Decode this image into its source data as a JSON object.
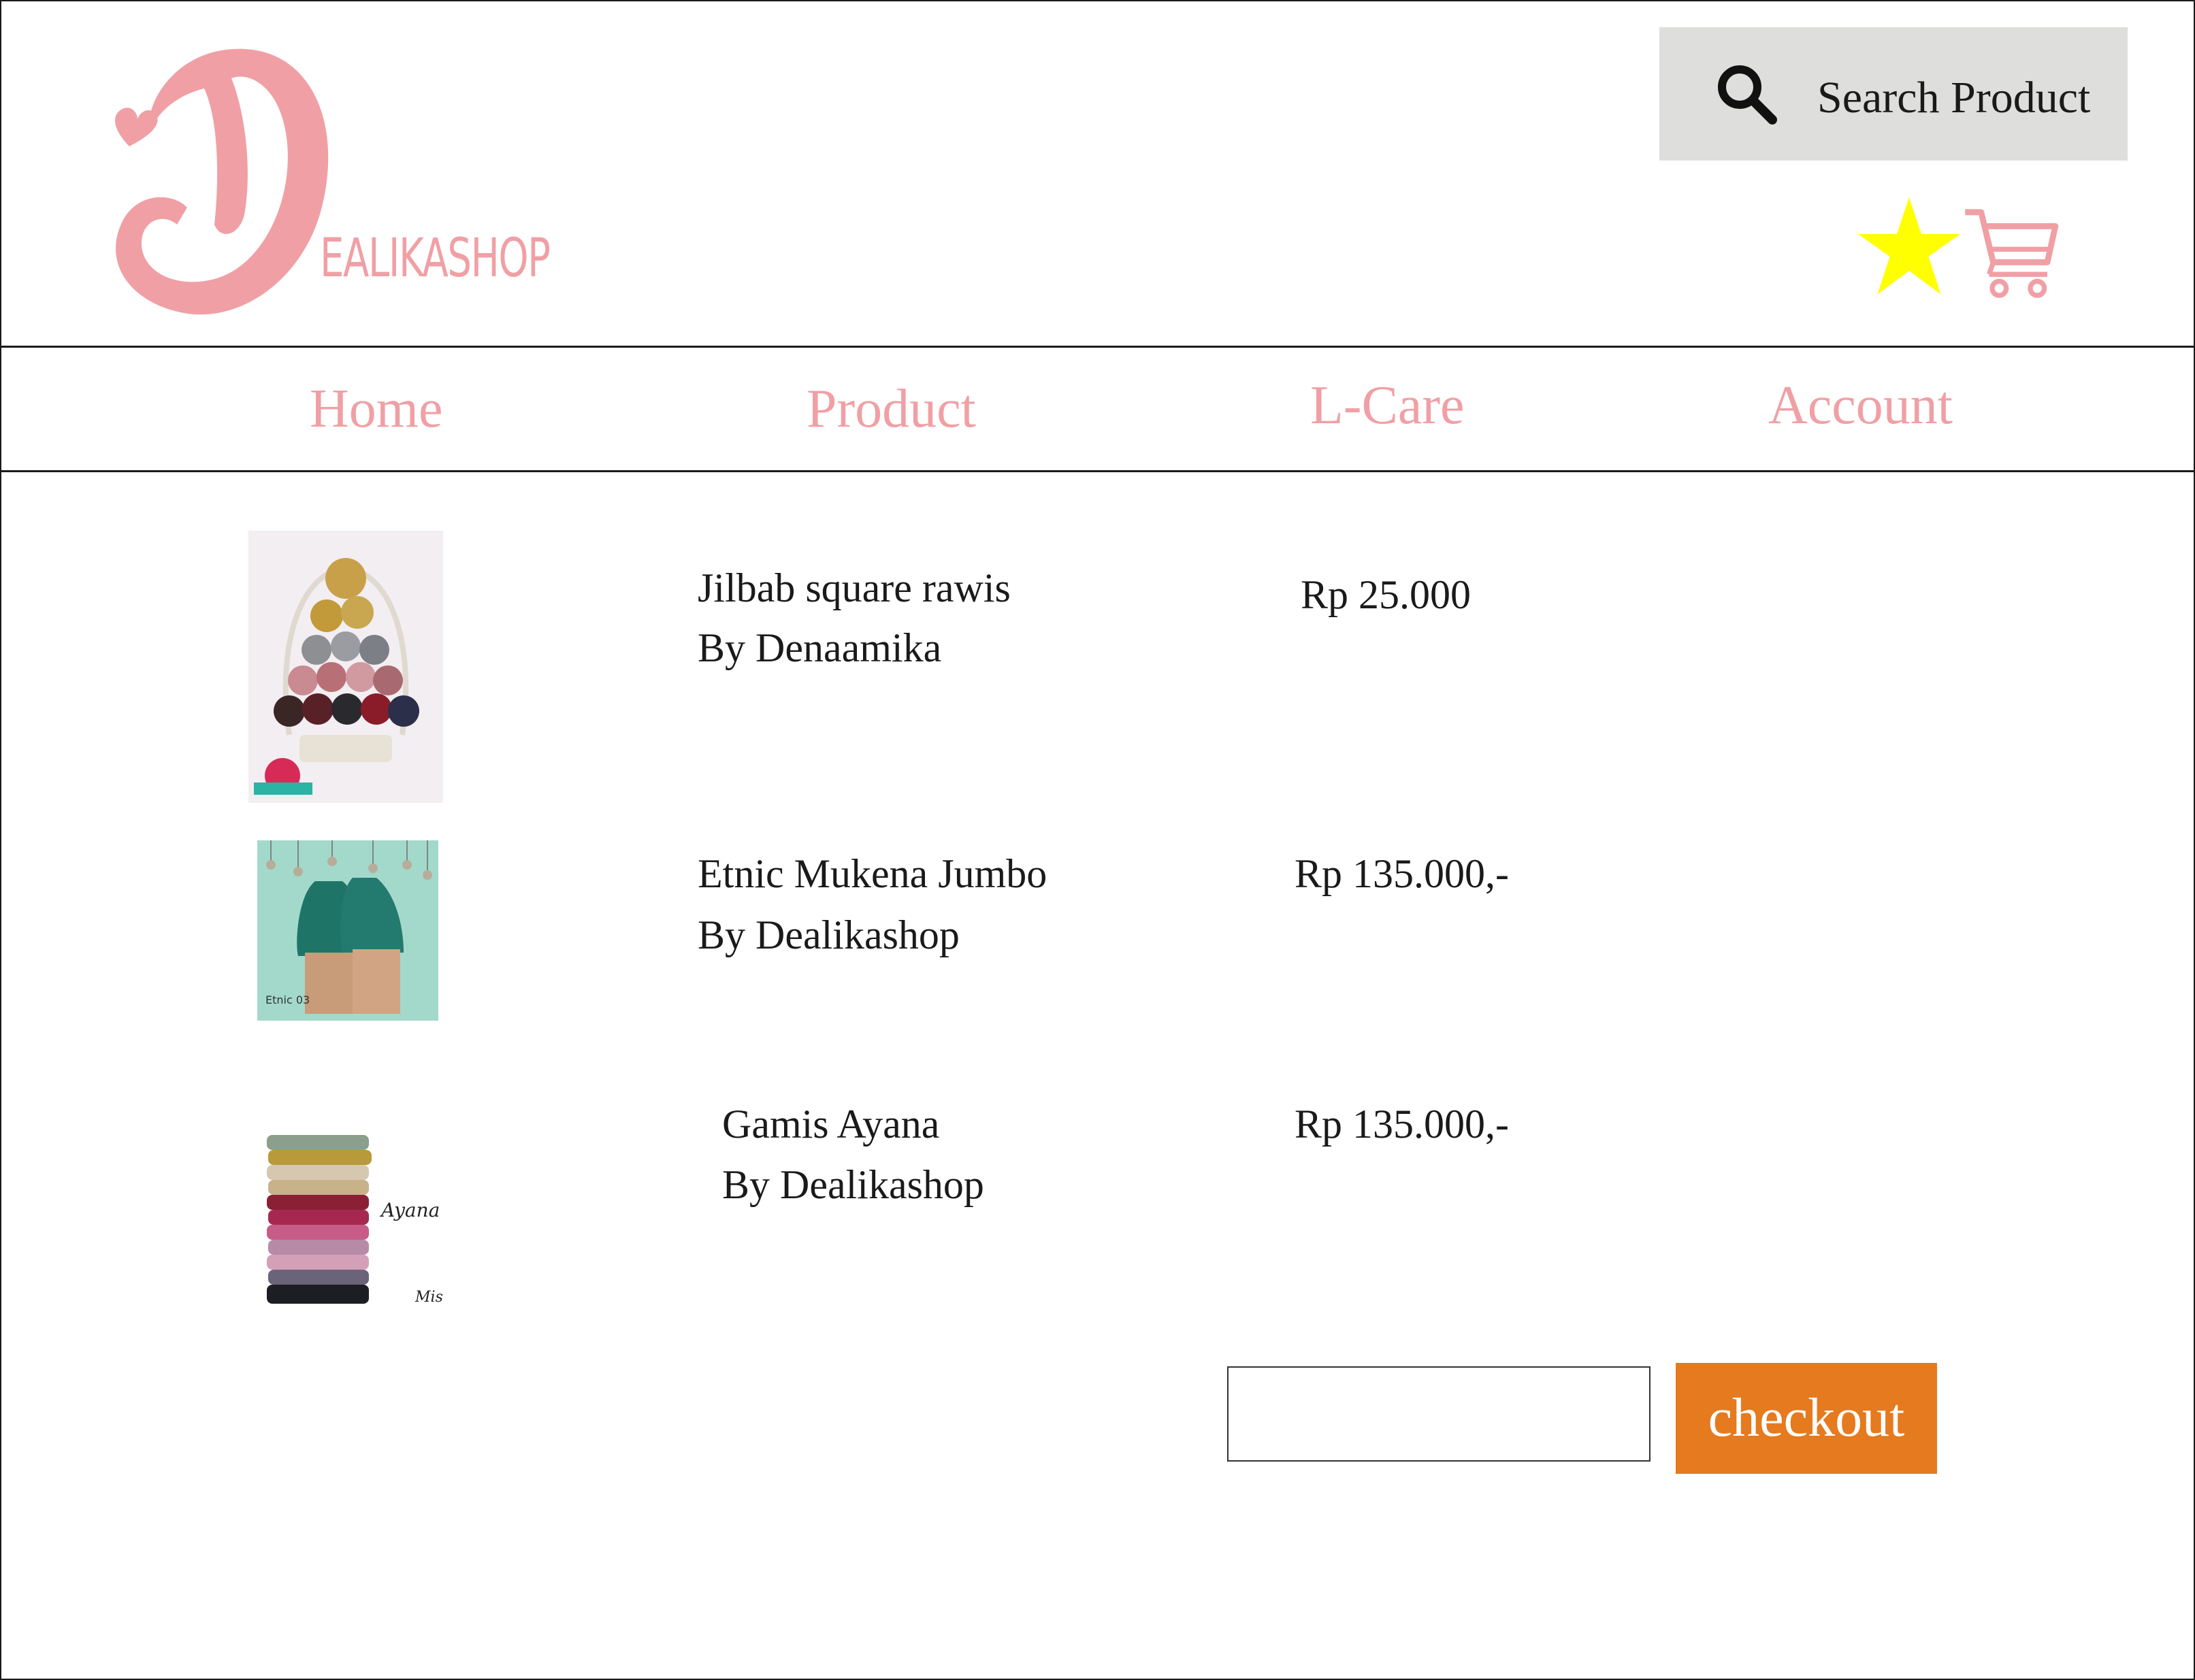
{
  "brand": {
    "logo_text": "EALIKASHOP",
    "accent": "#f0a0a5"
  },
  "search": {
    "label": "Search Product",
    "icon": "search-icon"
  },
  "header_icons": {
    "favorites": "star-icon",
    "cart": "cart-icon",
    "star_color": "#ffff00"
  },
  "nav": {
    "items": [
      {
        "label": "Home"
      },
      {
        "label": "Product"
      },
      {
        "label": "L-Care"
      },
      {
        "label": "Account"
      }
    ]
  },
  "cart_items": [
    {
      "name": "Jilbab square rawis",
      "seller": "By Denaamika",
      "price": "Rp 25.000"
    },
    {
      "name": "Etnic Mukena Jumbo",
      "seller": "By Dealikashop",
      "price": "Rp 135.000,-"
    },
    {
      "name": "Gamis Ayana",
      "seller": "By Dealikashop",
      "price": "Rp 135.000,-"
    }
  ],
  "checkout": {
    "input_value": "",
    "button_label": "checkout",
    "button_color": "#e57a1e"
  }
}
